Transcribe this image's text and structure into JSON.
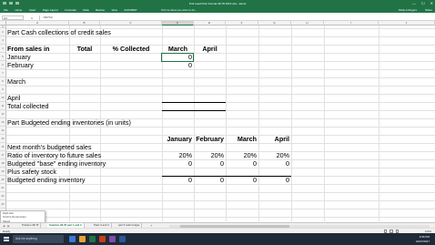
{
  "window": {
    "title": "Prof Lead Prob Format 28-78 2015.xlsx - Excel",
    "controls": [
      "—",
      "☐",
      "✕"
    ]
  },
  "ribbon": {
    "tabs": [
      "File",
      "Home",
      "Insert",
      "Page Layout",
      "Formulas",
      "Data",
      "Review",
      "View",
      "ACROBAT"
    ],
    "tell_me": "Tell me what you want to do...",
    "user": "Molly A Rogers",
    "share": "Share"
  },
  "formula_bar": {
    "name_box": "A4",
    "fx": "fx",
    "formula": "=D4*C4"
  },
  "columns": [
    {
      "label": "A",
      "selected": false
    },
    {
      "label": "B",
      "selected": false
    },
    {
      "label": "C",
      "selected": false
    },
    {
      "label": "D",
      "selected": true
    },
    {
      "label": "E",
      "selected": false
    },
    {
      "label": "F",
      "selected": false
    },
    {
      "label": "G",
      "selected": false
    },
    {
      "label": "H",
      "selected": false
    },
    {
      "label": "I",
      "selected": false
    },
    {
      "label": "J",
      "selected": false
    }
  ],
  "rows": [
    "1",
    "2",
    "3",
    "4",
    "5",
    "6",
    "7",
    "8",
    "9",
    "10",
    "11",
    "12",
    "13",
    "14",
    "15",
    "16",
    "17",
    "18",
    "19",
    "20",
    "21",
    "22",
    "23",
    "24",
    "25"
  ],
  "sheet": {
    "part1_title": "Part  Cash collections of credit sales",
    "from_sales_in": "From sales in",
    "total_hdr": "Total",
    "pct_collected_hdr": "% Collected",
    "march_hdr": "March",
    "april_hdr": "April",
    "january": "January",
    "january_march_val": "0",
    "february": "February",
    "february_march_val": "0",
    "march": "March",
    "april": "April",
    "total_collected": "Total collected",
    "part2_title": "Part  Budgeted ending inventories (in units)",
    "month_headers": [
      "January",
      "February",
      "March",
      "April"
    ],
    "next_month_sales": "Next month's budgeted sales",
    "ratio_label": "Ratio of inventory to future sales",
    "ratio_values": [
      "20%",
      "20%",
      "20%",
      "20%"
    ],
    "base_inv_label": "Budgeted \"base\" ending inventory",
    "base_inv_values": [
      "0",
      "0",
      "0",
      "0"
    ],
    "safety_stock_label": "Plus safety stock",
    "ending_inv_label": "Budgeted ending inventory",
    "ending_inv_values": [
      "0",
      "0",
      "0",
      "0"
    ]
  },
  "context_menu": {
    "items": [
      "Right-click",
      "Scroll to the last sheet",
      "Sheets"
    ]
  },
  "sheet_tabs": [
    {
      "label": "Problem 28-75",
      "active": false
    },
    {
      "label": "Solution 28-78 part 1 and 2",
      "active": true
    },
    {
      "label": "Parts 3 and 4",
      "active": false
    },
    {
      "label": "part 5 cash budget",
      "active": false
    }
  ],
  "add_sheet": "+",
  "status": {
    "ready": "Ready",
    "zoom": "100%"
  },
  "taskbar": {
    "search": "Ask me anything",
    "time": "9:36 PM",
    "date": "10/27/2017",
    "app_colors": [
      "#3b78d8",
      "#e8a33a",
      "#217346",
      "#c43e1c",
      "#7a4fb0",
      "#2b579a"
    ]
  },
  "colors": {
    "brand": "#217346",
    "taskbar": "#1f2a38"
  }
}
